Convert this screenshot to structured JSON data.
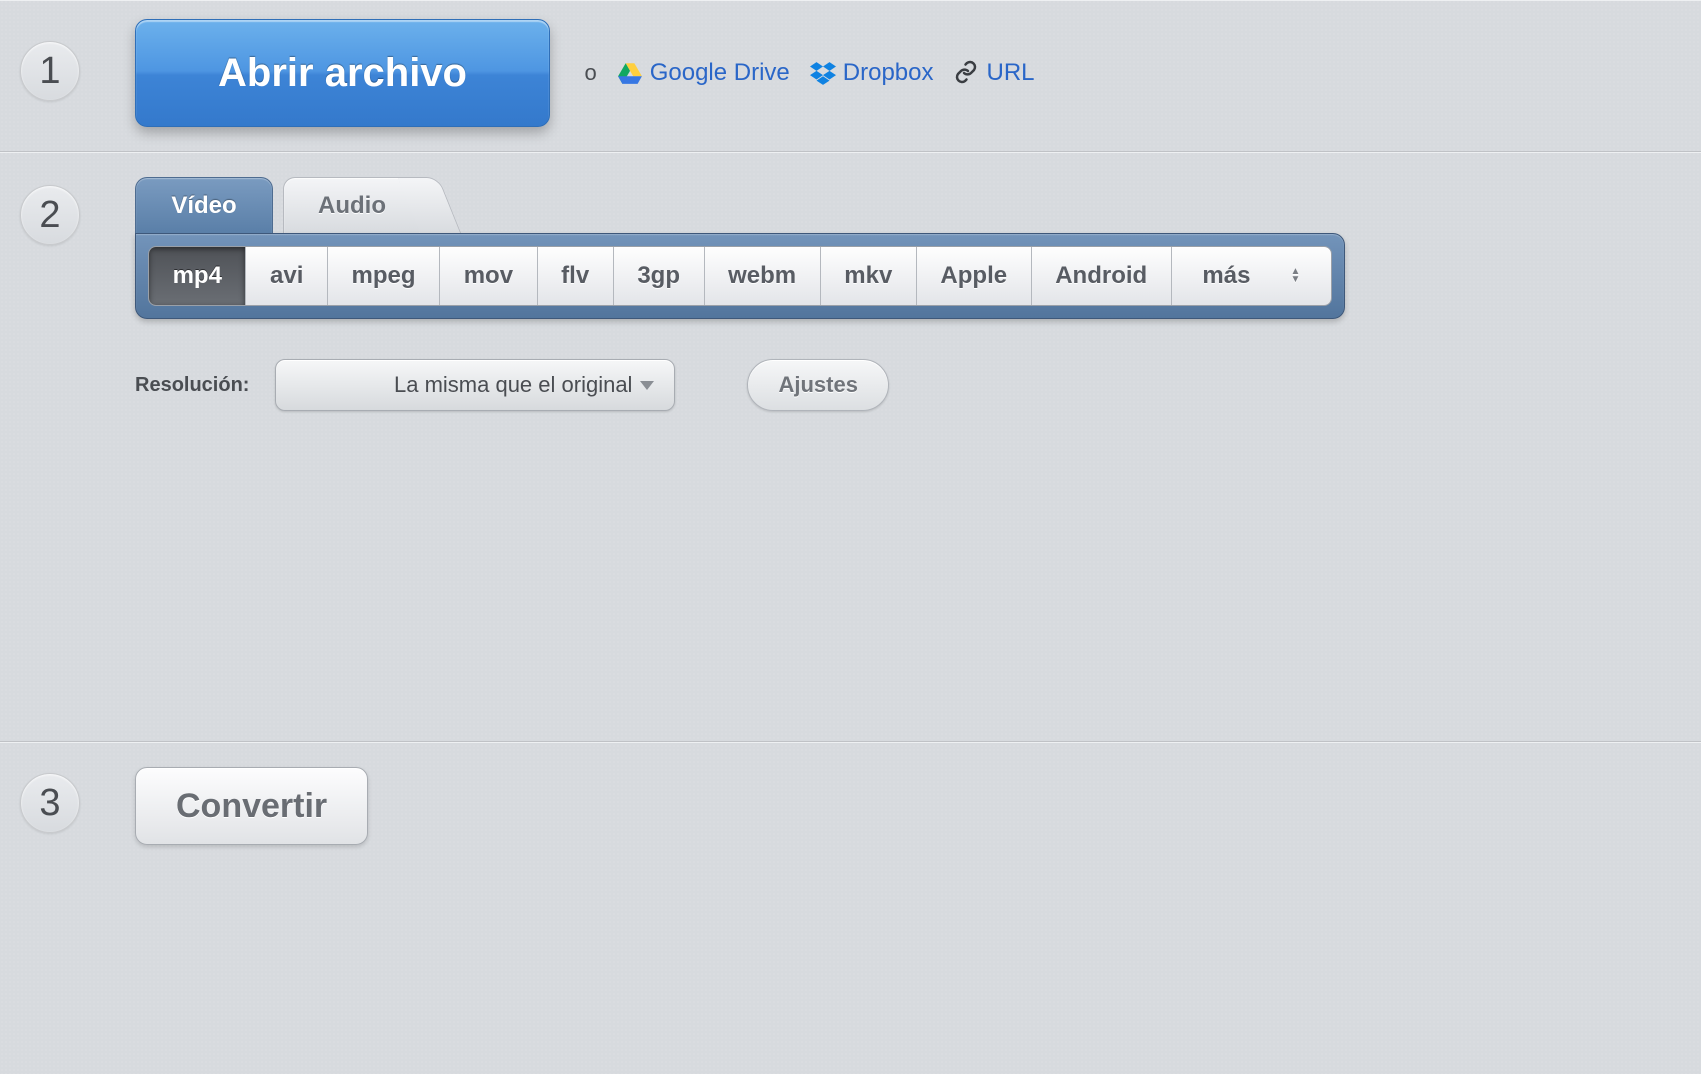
{
  "steps": {
    "one": "1",
    "two": "2",
    "three": "3"
  },
  "step1": {
    "open_file_label": "Abrir archivo",
    "or_label": "o",
    "sources": {
      "gdrive": "Google Drive",
      "dropbox": "Dropbox",
      "url": "URL"
    }
  },
  "step2": {
    "tabs": {
      "video": "Vídeo",
      "audio": "Audio"
    },
    "formats": [
      "mp4",
      "avi",
      "mpeg",
      "mov",
      "flv",
      "3gp",
      "webm",
      "mkv",
      "Apple",
      "Android",
      "más"
    ],
    "selected_format": "mp4",
    "resolution_label": "Resolución:",
    "resolution_value": "La misma que el original",
    "settings_label": "Ajustes"
  },
  "step3": {
    "convert_label": "Convertir"
  }
}
